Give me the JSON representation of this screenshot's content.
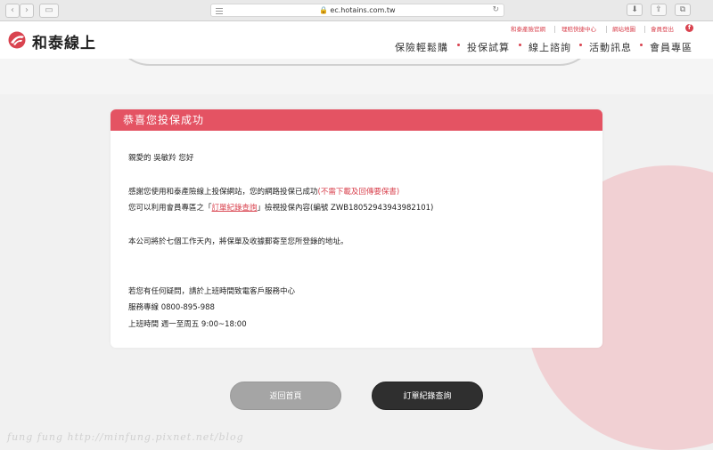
{
  "browser": {
    "url": "ec.hotains.com.tw"
  },
  "site": {
    "logo_text": "和泰線上",
    "brand_color": "#d9434f",
    "util_links": [
      "和泰產險官網",
      "理賠快捷中心",
      "網站地圖",
      "會員登出"
    ],
    "nav": [
      "保險輕鬆購",
      "投保試算",
      "線上諮詢",
      "活動訊息",
      "會員專區"
    ]
  },
  "card": {
    "title": "恭喜您投保成功",
    "greeting": "親愛的 吳敏羚 您好",
    "line1_prefix": "感謝您使用和泰產險線上投保網站，您的網路投保已成功",
    "line1_note": "(不需下載及回傳要保書)",
    "line2_prefix": "您可以利用會員專區之「",
    "line2_link": "訂單紀錄查詢",
    "line2_suffix": "」檢視投保內容(編號 ZWB18052943943982101)",
    "line3": "本公司將於七個工作天內，將保單及收據郵寄至您所登錄的地址。",
    "contact_q": "若您有任何疑問，請於上班時間致電客戶服務中心",
    "hotline": "服務專線 0800-895-988",
    "hours": "上班時間 週一至周五 9:00~18:00"
  },
  "buttons": {
    "home": "返回首頁",
    "orders": "訂單紀錄查詢"
  },
  "watermark": "fung fung   http://minfung.pixnet.net/blog"
}
